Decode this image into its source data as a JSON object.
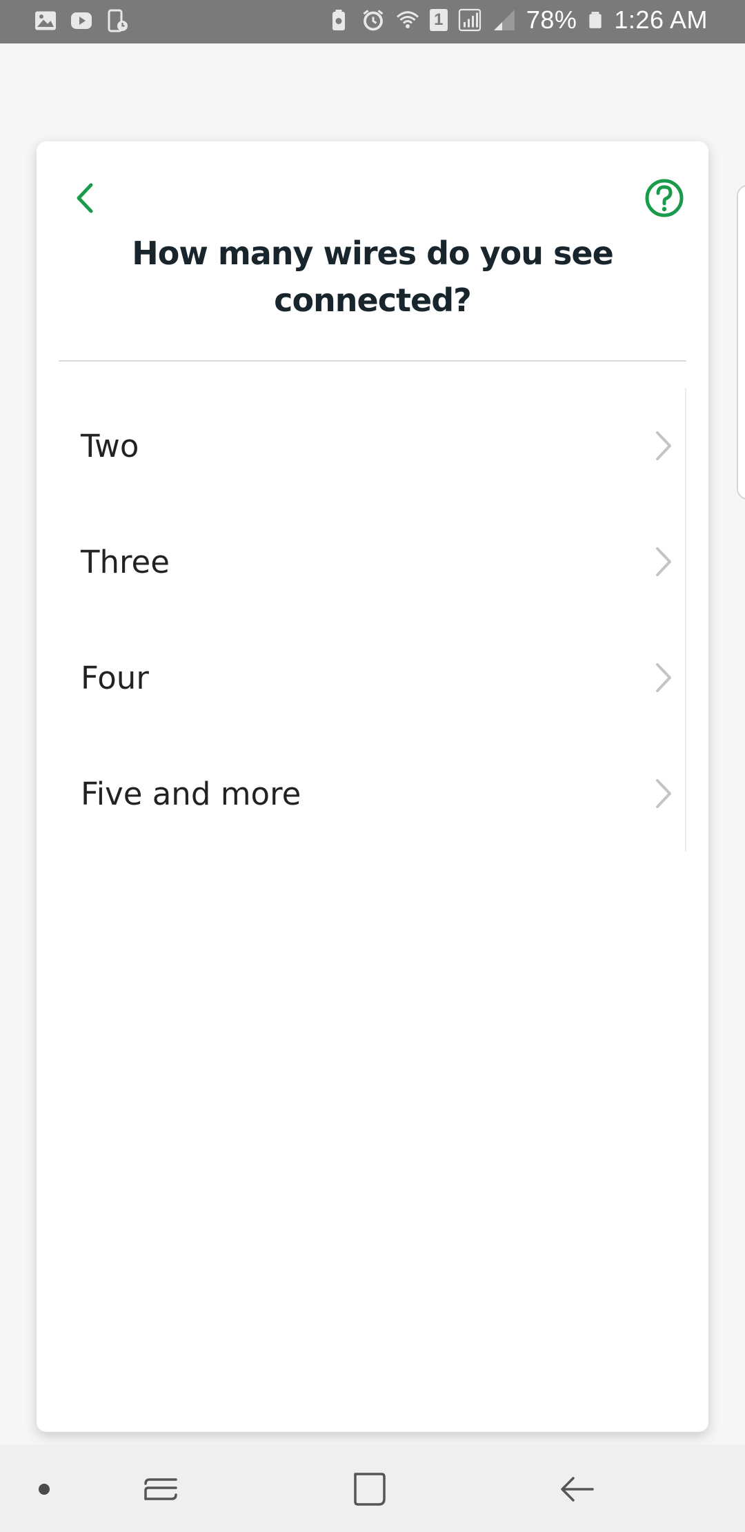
{
  "status_bar": {
    "battery_percent": "78%",
    "time": "1:26 AM",
    "sim_badge": "1",
    "left_icons": [
      "image-icon",
      "youtube-icon",
      "screen-recorder-icon"
    ],
    "right_icons": [
      "battery-saver-icon",
      "alarm-icon",
      "wifi-icon",
      "sim-icon",
      "signal-icon",
      "signal-weak-icon",
      "battery-icon"
    ]
  },
  "header": {
    "title": "How many wires do you see connected?",
    "back_icon": "chevron-left-icon",
    "help_icon": "help-circle-icon",
    "accent_color": "#1a9b4b"
  },
  "options": [
    {
      "label": "Two"
    },
    {
      "label": "Three"
    },
    {
      "label": "Four"
    },
    {
      "label": "Five and more"
    }
  ],
  "nav_bar": {
    "buttons": [
      "dot-icon",
      "recent-apps-icon",
      "home-icon",
      "back-icon"
    ]
  }
}
